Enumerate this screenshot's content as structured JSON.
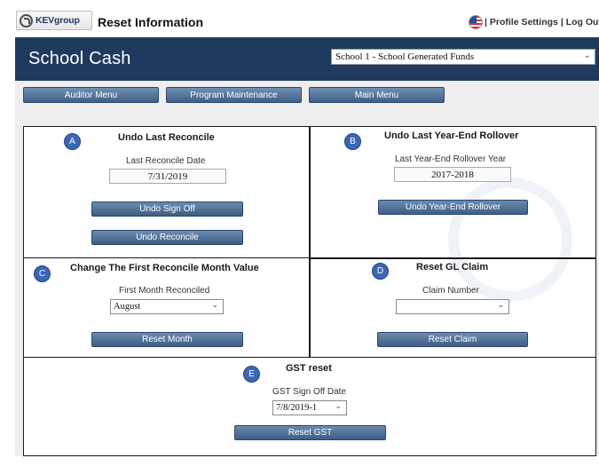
{
  "topbar": {
    "logo_text": "KEVgroup",
    "page_title": "Reset Information",
    "links": {
      "sep1": "|",
      "profile": "Profile Settings",
      "sep2": "|",
      "logout": "Log Out"
    }
  },
  "header": {
    "app_title": "School Cash",
    "school_select": "School 1 - School Generated Funds"
  },
  "menu": {
    "auditor": "Auditor Menu",
    "program": "Program Maintenance",
    "main": "Main Menu"
  },
  "panels": {
    "a": {
      "badge": "A",
      "title": "Undo Last Reconcile",
      "field_label": "Last Reconcile Date",
      "field_value": "7/31/2019",
      "button1": "Undo Sign Off",
      "button2": "Undo Reconcile"
    },
    "b": {
      "badge": "B",
      "title": "Undo Last Year-End Rollover",
      "field_label": "Last Year-End Rollover Year",
      "field_value": "2017-2018",
      "button1": "Undo Year-End Rollover"
    },
    "c": {
      "badge": "C",
      "title": "Change The First Reconcile Month Value",
      "field_label": "First Month Reconciled",
      "dropdown_value": "August",
      "button1": "Reset Month"
    },
    "d": {
      "badge": "D",
      "title": "Reset GL Claim",
      "field_label": "Claim Number",
      "dropdown_value": "",
      "button1": "Reset Claim"
    },
    "e": {
      "badge": "E",
      "title": "GST reset",
      "field_label": "GST Sign Off Date",
      "dropdown_value": "7/8/2019-1",
      "button1": "Reset GST"
    }
  },
  "icons": {
    "logo": "kevgroup-logo-icon",
    "flag": "us-flag-icon",
    "chevron": "chevron-down-icon"
  },
  "colors": {
    "header": "#1f3a5e",
    "button": "#4a6a90",
    "badge": "#3a67b6"
  }
}
